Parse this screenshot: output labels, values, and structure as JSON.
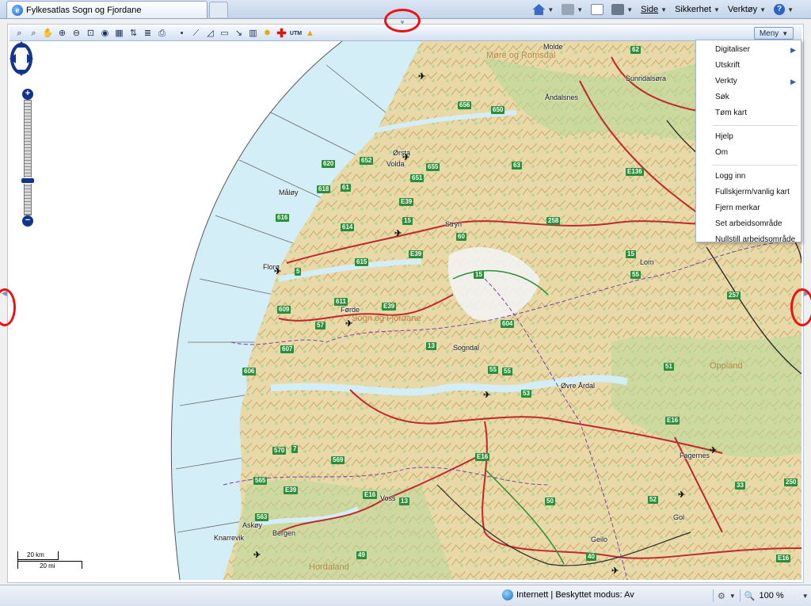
{
  "browser": {
    "tab_title": "Fylkesatlas Sogn og Fjordane",
    "command_bar": {
      "side": "Side",
      "sikkerhet": "Sikkerhet",
      "verktoy": "Verktøy"
    },
    "status": {
      "zone": "Internett | Beskyttet modus: Av",
      "zoom": "100 %"
    }
  },
  "toolbar": {
    "tools": [
      "binoculars-icon",
      "binoculars-2-icon",
      "pan-hand-icon",
      "zoom-in-icon",
      "zoom-out-icon",
      "zoom-extent-icon",
      "globe-icon",
      "scale-icon",
      "transfer-icon",
      "layers-icon",
      "print-icon",
      "point-icon",
      "line-icon",
      "polygon-icon",
      "rectangle-icon",
      "measure-icon",
      "book-icon",
      "sun-icon",
      "red-cross-icon",
      "utm-icon",
      "terrain-icon"
    ],
    "utm_label": "UTM",
    "meny_label": "Meny"
  },
  "menu": {
    "items": [
      {
        "label": "Digitaliser",
        "submenu": true
      },
      {
        "label": "Utskrift",
        "submenu": false
      },
      {
        "label": "Verkty",
        "submenu": true
      },
      {
        "label": "Søk",
        "submenu": false
      },
      {
        "label": "Tøm kart",
        "submenu": false
      },
      {
        "label": "Hjelp",
        "submenu": false
      },
      {
        "label": "Om",
        "submenu": false
      },
      {
        "label": "Logg inn",
        "submenu": false
      },
      {
        "label": "Fullskjerm/vanlig kart",
        "submenu": false
      },
      {
        "label": "Fjern merkar",
        "submenu": false
      },
      {
        "label": "Set arbeidsområde",
        "submenu": false
      },
      {
        "label": "Nullstill arbeidsområde",
        "submenu": false
      }
    ]
  },
  "map": {
    "regions": [
      "Møre og Romsdal",
      "Sogn og Fjordane",
      "Oppland",
      "Hordaland"
    ],
    "places": [
      "Molde",
      "Sunndalsøra",
      "Åndalsnes",
      "Ørsta",
      "Volda",
      "Måløy",
      "Stryn",
      "Florø",
      "Førde",
      "Lom",
      "Sogndal",
      "Øvre Årdal",
      "Fagernes",
      "Voss",
      "Gol",
      "Askøy",
      "Knarrevik",
      "Bergen",
      "Geilo"
    ],
    "roads": [
      "656",
      "650",
      "62",
      "620",
      "652",
      "655",
      "63",
      "618",
      "61",
      "651",
      "E39",
      "E136",
      "616",
      "614",
      "15",
      "258",
      "60",
      "615",
      "5",
      "15",
      "611",
      "E39",
      "609",
      "57",
      "604",
      "55",
      "257",
      "607",
      "13",
      "55",
      "51",
      "606",
      "53",
      "E16",
      "570",
      "569",
      "E16",
      "565",
      "E39",
      "E16",
      "50",
      "52",
      "33",
      "250",
      "563",
      "13",
      "49",
      "40",
      "E16",
      "7",
      "E39",
      "15",
      "55",
      "55"
    ],
    "scale": {
      "km": "20 km",
      "mi": "20 mi"
    }
  },
  "colors": {
    "land": "#e9d9a8",
    "sea": "#d3eef6",
    "forest": "#b8d899",
    "road_red": "#c0282e",
    "road_number_bg": "#2d8d3a",
    "county_border": "#7a3fa0",
    "highlight": "#e11111"
  }
}
